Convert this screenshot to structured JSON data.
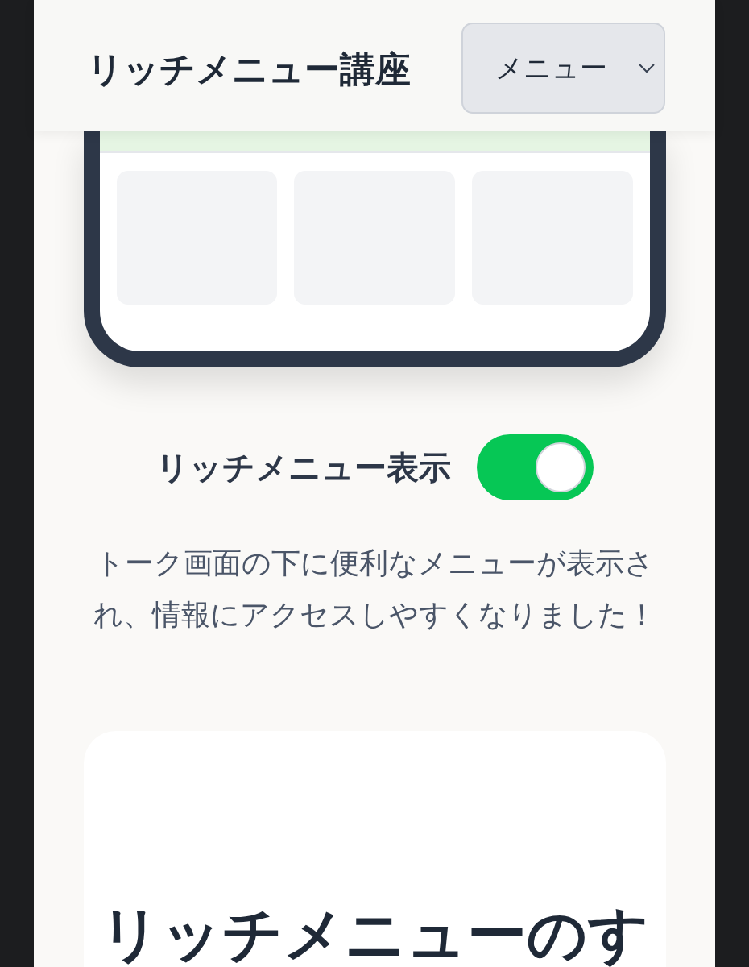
{
  "header": {
    "title": "リッチメニュー講座",
    "menu_select": {
      "value": "メニュー"
    }
  },
  "toggle": {
    "label": "リッチメニュー表示",
    "on": true
  },
  "description": "トーク画面の下に便利なメニューが表示され、情報にアクセスしやすくなりました！",
  "card": {
    "heading": "リッチメニューのす"
  }
}
